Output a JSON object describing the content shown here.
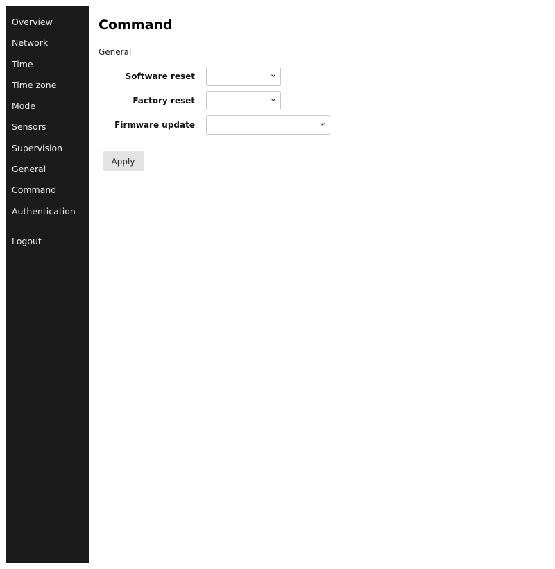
{
  "sidebar": {
    "items": [
      {
        "label": "Overview"
      },
      {
        "label": "Network"
      },
      {
        "label": "Time"
      },
      {
        "label": "Time zone"
      },
      {
        "label": "Mode"
      },
      {
        "label": "Sensors"
      },
      {
        "label": "Supervision"
      },
      {
        "label": "General"
      },
      {
        "label": "Command"
      },
      {
        "label": "Authentication"
      }
    ],
    "logout_label": "Logout"
  },
  "main": {
    "title": "Command",
    "section_title": "General",
    "fields": {
      "software_reset": {
        "label": "Software reset",
        "value": ""
      },
      "factory_reset": {
        "label": "Factory reset",
        "value": ""
      },
      "firmware_update": {
        "label": "Firmware update",
        "value": ""
      }
    },
    "apply_label": "Apply"
  }
}
